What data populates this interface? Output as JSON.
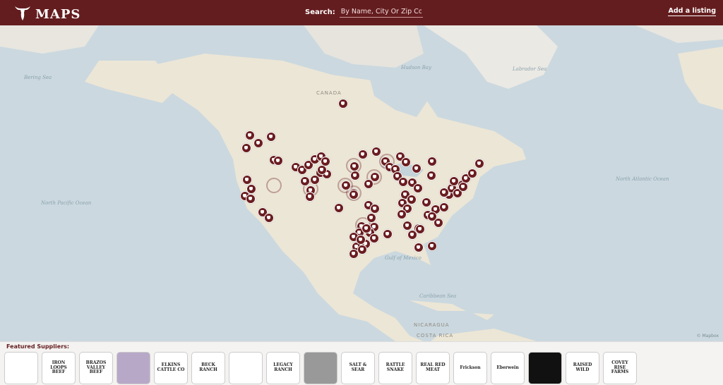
{
  "header": {
    "logo_text": "MAPS",
    "search_label": "Search:",
    "search_placeholder": "By Name, City Or Zip Code",
    "add_listing": "Add a listing"
  },
  "map": {
    "labels": {
      "bering": "Bering Sea",
      "hudson": "Hudson Bay",
      "labrador": "Labrador Sea",
      "canada": "CANADA",
      "north_pacific": "North Pacific Ocean",
      "north_atlantic": "North Atlantic Ocean",
      "gulf_mexico": "Gulf of Mexico",
      "caribbean": "Caribbean Sea",
      "nicaragua": "NICARAGUA",
      "costa_rica": "COSTA RICA"
    },
    "attribution": "© Mapbox",
    "marker_color": "#6b1d20"
  },
  "suppliers": {
    "title": "Featured Suppliers:",
    "items": [
      {
        "name": "",
        "style": "plain"
      },
      {
        "name": "IRON LOOPS BEEF",
        "style": "plain"
      },
      {
        "name": "BRAZOS VALLEY BEEF",
        "style": "plain"
      },
      {
        "name": "",
        "style": "photo"
      },
      {
        "name": "ELKINS CATTLE CO",
        "style": "plain"
      },
      {
        "name": "BECK RANCH",
        "style": "plain"
      },
      {
        "name": "",
        "style": "plain"
      },
      {
        "name": "LEGACY RANCH",
        "style": "plain"
      },
      {
        "name": "",
        "style": "grey"
      },
      {
        "name": "SALT & SEAR",
        "style": "plain"
      },
      {
        "name": "RATTLE SNAKE",
        "style": "plain"
      },
      {
        "name": "REAL RED MEAT",
        "style": "plain"
      },
      {
        "name": "Frickson",
        "style": "plain"
      },
      {
        "name": "Eberwein",
        "style": "plain"
      },
      {
        "name": "",
        "style": "dark"
      },
      {
        "name": "RAISED WILD",
        "style": "plain"
      },
      {
        "name": "COVEY RISE FARMS",
        "style": "plain"
      }
    ]
  }
}
